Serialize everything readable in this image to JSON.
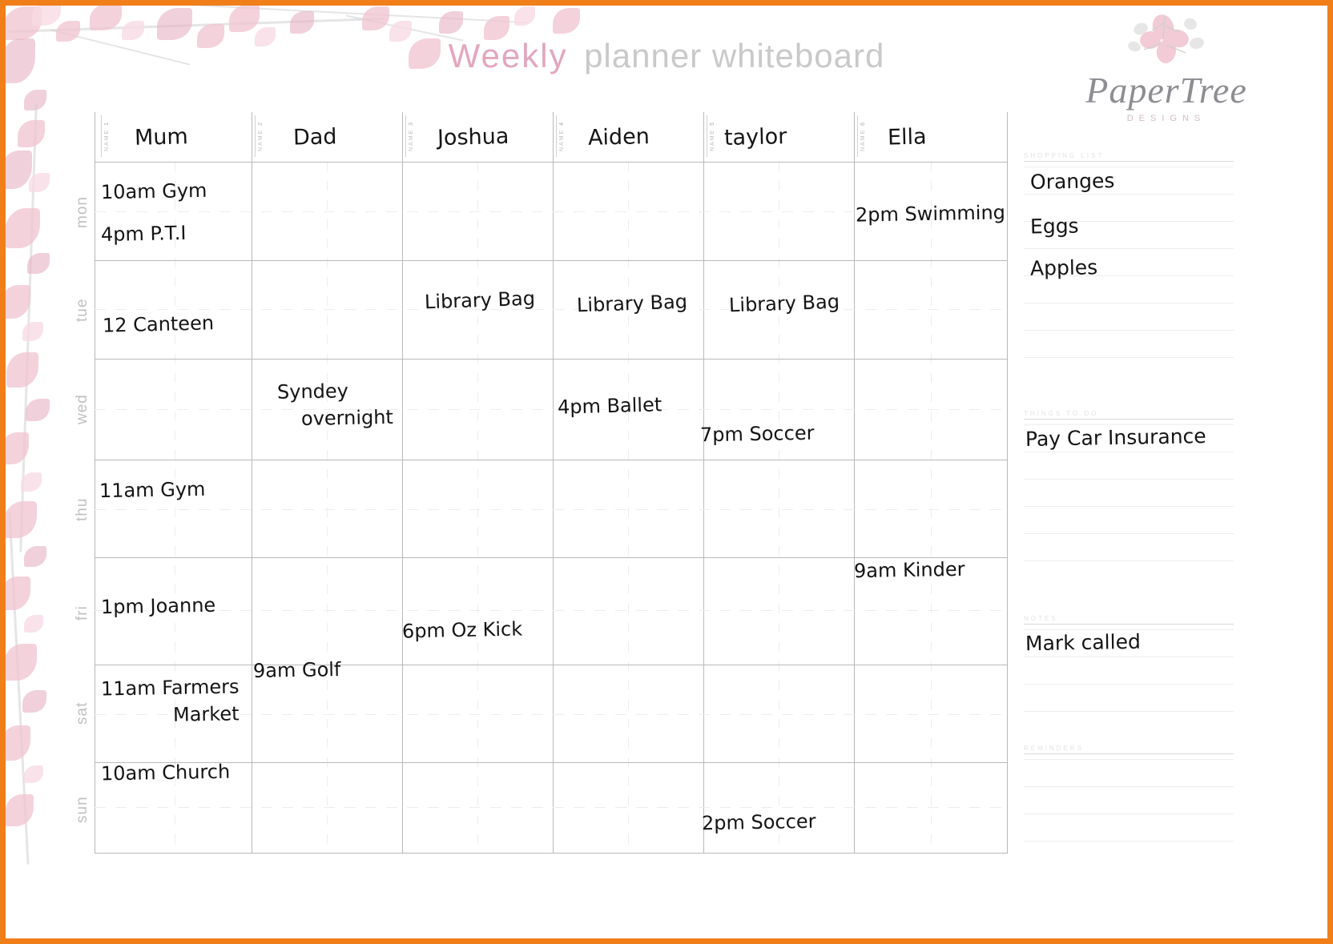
{
  "header": {
    "title_primary": "Weekly",
    "title_secondary": "planner whiteboard"
  },
  "logo": {
    "name": "PaperTree",
    "subtitle": "DESIGNS",
    "blossom_icon": "cherry-blossom-icon"
  },
  "accent_colors": {
    "frame": "#f07f1a",
    "title_pink": "#e3a7bb",
    "title_gray": "#c9c9c9",
    "grid_line": "#b9b9b9",
    "ink": "#141414",
    "floral_pink": "#f0c3cf"
  },
  "grid": {
    "name_label": "NAME",
    "columns": [
      {
        "index": "1",
        "name": "Mum"
      },
      {
        "index": "2",
        "name": "Dad"
      },
      {
        "index": "3",
        "name": "Joshua"
      },
      {
        "index": "4",
        "name": "Aiden"
      },
      {
        "index": "5",
        "name": "taylor"
      },
      {
        "index": "6",
        "name": "Ella"
      }
    ],
    "days": [
      "mon",
      "tue",
      "wed",
      "thu",
      "fri",
      "sat",
      "sun"
    ]
  },
  "entries": [
    {
      "day": "mon",
      "person": "Mum",
      "text": "10am Gym"
    },
    {
      "day": "mon",
      "person": "Mum",
      "text": "4pm P.T.I"
    },
    {
      "day": "mon",
      "person": "Ella",
      "text": "2pm Swimming"
    },
    {
      "day": "tue",
      "person": "Mum",
      "text": "12 Canteen"
    },
    {
      "day": "tue",
      "person": "Joshua",
      "text": "Library Bag"
    },
    {
      "day": "tue",
      "person": "Aiden",
      "text": "Library Bag"
    },
    {
      "day": "tue",
      "person": "taylor",
      "text": "Library Bag"
    },
    {
      "day": "wed",
      "person": "Dad",
      "text": "Syndey"
    },
    {
      "day": "wed",
      "person": "Dad",
      "text": "overnight"
    },
    {
      "day": "wed",
      "person": "Aiden",
      "text": "4pm Ballet"
    },
    {
      "day": "wed",
      "person": "taylor",
      "text": "7pm Soccer"
    },
    {
      "day": "thu",
      "person": "Mum",
      "text": "11am Gym"
    },
    {
      "day": "fri",
      "person": "Ella",
      "text": "9am Kinder"
    },
    {
      "day": "fri",
      "person": "Mum",
      "text": "1pm Joanne"
    },
    {
      "day": "fri",
      "person": "Joshua",
      "text": "6pm Oz Kick"
    },
    {
      "day": "sat",
      "person": "Dad",
      "text": "9am Golf"
    },
    {
      "day": "sat",
      "person": "Mum",
      "text": "11am Farmers"
    },
    {
      "day": "sat",
      "person": "Mum",
      "text": "Market"
    },
    {
      "day": "sun",
      "person": "Mum",
      "text": "10am Church"
    },
    {
      "day": "sun",
      "person": "taylor",
      "text": "2pm Soccer"
    }
  ],
  "sidebar": {
    "sections": [
      {
        "heading": "SHOPPING LIST",
        "items": [
          "Oranges",
          "Eggs",
          "Apples"
        ]
      },
      {
        "heading": "THINGS TO DO",
        "items": [
          "Pay Car Insurance"
        ]
      },
      {
        "heading": "NOTES",
        "items": [
          "Mark called"
        ]
      },
      {
        "heading": "REMINDERS",
        "items": []
      }
    ]
  }
}
